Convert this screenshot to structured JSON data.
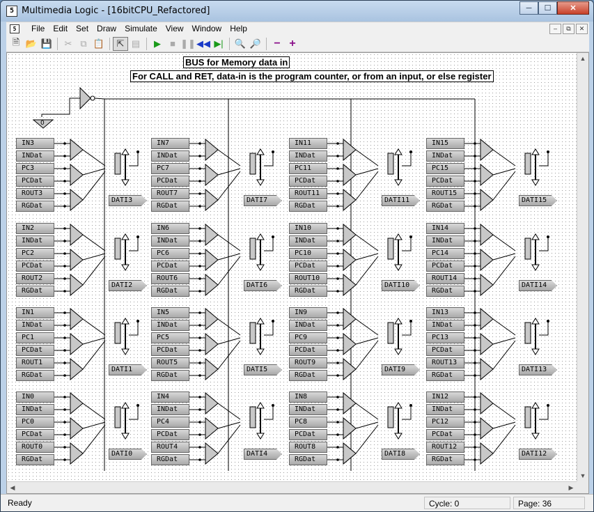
{
  "window": {
    "title": "Multimedia Logic - [16bitCPU_Refactored]",
    "app_icon": "5"
  },
  "menu": {
    "items": [
      "File",
      "Edit",
      "Set",
      "Draw",
      "Simulate",
      "View",
      "Window",
      "Help"
    ]
  },
  "toolbar": {
    "icons": [
      "new-icon",
      "open-icon",
      "save-icon",
      "cut-icon",
      "copy-icon",
      "paste-icon",
      "select-icon",
      "text-icon",
      "run-icon",
      "stop-icon",
      "pause-icon",
      "step-back-icon",
      "step-icon",
      "zoom-out-icon",
      "zoom-in-icon",
      "minus-icon",
      "plus-icon"
    ]
  },
  "canvas": {
    "labels": {
      "bus": "BUS for Memory data in",
      "note": "For CALL and RET, data-in is the program counter, or from an input, or else register"
    },
    "ground_label": "0",
    "banks": [
      {
        "tags": [
          "IN3",
          "INDat",
          "PC3",
          "PCDat",
          "ROUT3",
          "RGDat"
        ],
        "out": "DATI3"
      },
      {
        "tags": [
          "IN2",
          "INDat",
          "PC2",
          "PCDat",
          "ROUT2",
          "RGDat"
        ],
        "out": "DATI2"
      },
      {
        "tags": [
          "IN1",
          "INDat",
          "PC1",
          "PCDat",
          "ROUT1",
          "RGDat"
        ],
        "out": "DATI1"
      },
      {
        "tags": [
          "IN0",
          "INDat",
          "PC0",
          "PCDat",
          "ROUT0",
          "RGDat"
        ],
        "out": "DATI0"
      },
      {
        "tags": [
          "IN7",
          "INDat",
          "PC7",
          "PCDat",
          "ROUT7",
          "RGDat"
        ],
        "out": "DATI7"
      },
      {
        "tags": [
          "IN6",
          "INDat",
          "PC6",
          "PCDat",
          "ROUT6",
          "RGDat"
        ],
        "out": "DATI6"
      },
      {
        "tags": [
          "IN5",
          "INDat",
          "PC5",
          "PCDat",
          "ROUT5",
          "RGDat"
        ],
        "out": "DATI5"
      },
      {
        "tags": [
          "IN4",
          "INDat",
          "PC4",
          "PCDat",
          "ROUT4",
          "RGDat"
        ],
        "out": "DATI4"
      },
      {
        "tags": [
          "IN11",
          "INDat",
          "PC11",
          "PCDat",
          "ROUT11",
          "RGDat"
        ],
        "out": "DATI11"
      },
      {
        "tags": [
          "IN10",
          "INDat",
          "PC10",
          "PCDat",
          "ROUT10",
          "RGDat"
        ],
        "out": "DATI10"
      },
      {
        "tags": [
          "IN9",
          "INDat",
          "PC9",
          "PCDat",
          "ROUT9",
          "RGDat"
        ],
        "out": "DATI9"
      },
      {
        "tags": [
          "IN8",
          "INDat",
          "PC8",
          "PCDat",
          "ROUT8",
          "RGDat"
        ],
        "out": "DATI8"
      },
      {
        "tags": [
          "IN15",
          "INDat",
          "PC15",
          "PCDat",
          "ROUT15",
          "RGDat"
        ],
        "out": "DATI15"
      },
      {
        "tags": [
          "IN14",
          "INDat",
          "PC14",
          "PCDat",
          "ROUT14",
          "RGDat"
        ],
        "out": "DATI14"
      },
      {
        "tags": [
          "IN13",
          "INDat",
          "PC13",
          "PCDat",
          "ROUT13",
          "RGDat"
        ],
        "out": "DATI13"
      },
      {
        "tags": [
          "IN12",
          "INDat",
          "PC12",
          "PCDat",
          "ROUT12",
          "RGDat"
        ],
        "out": "DATI12"
      }
    ]
  },
  "status": {
    "ready": "Ready",
    "cycle": "Cycle: 0",
    "page": "Page: 36"
  }
}
